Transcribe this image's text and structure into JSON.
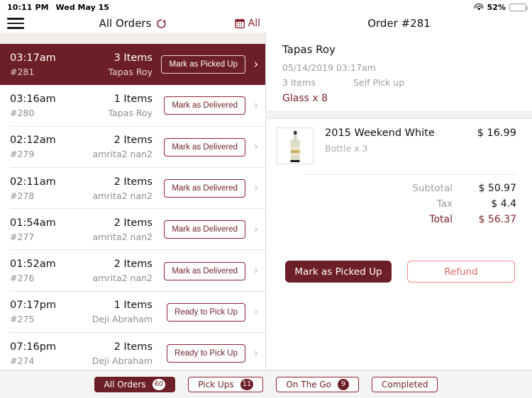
{
  "status_bar": {
    "time": "10:11 PM",
    "date": "Wed May 15",
    "battery_percent": "52%",
    "wifi_icon": "wifi-icon",
    "battery_icon": "battery-charging-icon"
  },
  "nav": {
    "menu_icon": "hamburger-menu-icon",
    "left_title": "All Orders",
    "refresh_icon": "refresh-icon",
    "calendar_icon": "calendar-icon",
    "calendar_filter_label": "All",
    "right_title": "Order #281"
  },
  "orders": [
    {
      "time": "03:17am",
      "id": "#281",
      "items": "3 Items",
      "customer": "Tapas Roy",
      "action": "Mark as Picked Up",
      "selected": true
    },
    {
      "time": "03:16am",
      "id": "#280",
      "items": "1 Items",
      "customer": "Tapas Roy",
      "action": "Mark as Delivered",
      "selected": false
    },
    {
      "time": "02:12am",
      "id": "#279",
      "items": "2 Items",
      "customer": "amrita2 nan2",
      "action": "Mark as Delivered",
      "selected": false
    },
    {
      "time": "02:11am",
      "id": "#278",
      "items": "2 Items",
      "customer": "amrita2 nan2",
      "action": "Mark as Delivered",
      "selected": false
    },
    {
      "time": "01:54am",
      "id": "#277",
      "items": "2 Items",
      "customer": "amrita2 nan2",
      "action": "Mark as Delivered",
      "selected": false
    },
    {
      "time": "01:52am",
      "id": "#276",
      "items": "2 Items",
      "customer": "amrita2 nan2",
      "action": "Mark as Delivered",
      "selected": false
    },
    {
      "time": "07:17pm",
      "id": "#275",
      "items": "1 Items",
      "customer": "Deji Abraham",
      "action": "Ready to Pick Up",
      "selected": false
    },
    {
      "time": "07:16pm",
      "id": "#274",
      "items": "2 Items",
      "customer": "Deji Abraham",
      "action": "Ready to Pick Up",
      "selected": false
    }
  ],
  "detail": {
    "customer": "Tapas Roy",
    "datetime": "05/14/2019 03:17am",
    "items_count": "3 Items",
    "fulfillment": "Self Pick up",
    "glass_line": "Glass x 8",
    "line_items": [
      {
        "name": "2015 Weekend White",
        "qty_label": "Bottle x 3",
        "price": "$ 16.99",
        "thumb_icon": "wine-bottle-image"
      }
    ],
    "totals": [
      {
        "label": "Subtotal",
        "value": "$ 50.97"
      },
      {
        "label": "Tax",
        "value": "$ 4.4"
      },
      {
        "label": "Total",
        "value": "$ 56.37"
      }
    ],
    "primary_action": "Mark as Picked Up",
    "secondary_action": "Refund"
  },
  "tabs": [
    {
      "label": "All Orders",
      "badge": "60",
      "active": true
    },
    {
      "label": "Pick Ups",
      "badge": "11",
      "active": false
    },
    {
      "label": "On The Go",
      "badge": "9",
      "active": false
    },
    {
      "label": "Completed",
      "badge": "",
      "active": false
    }
  ],
  "colors": {
    "brand_maroon": "#6d1f27",
    "brand_maroon_text": "#8d2230",
    "refund_red": "#e2696a",
    "battery_green": "#4cd562"
  }
}
